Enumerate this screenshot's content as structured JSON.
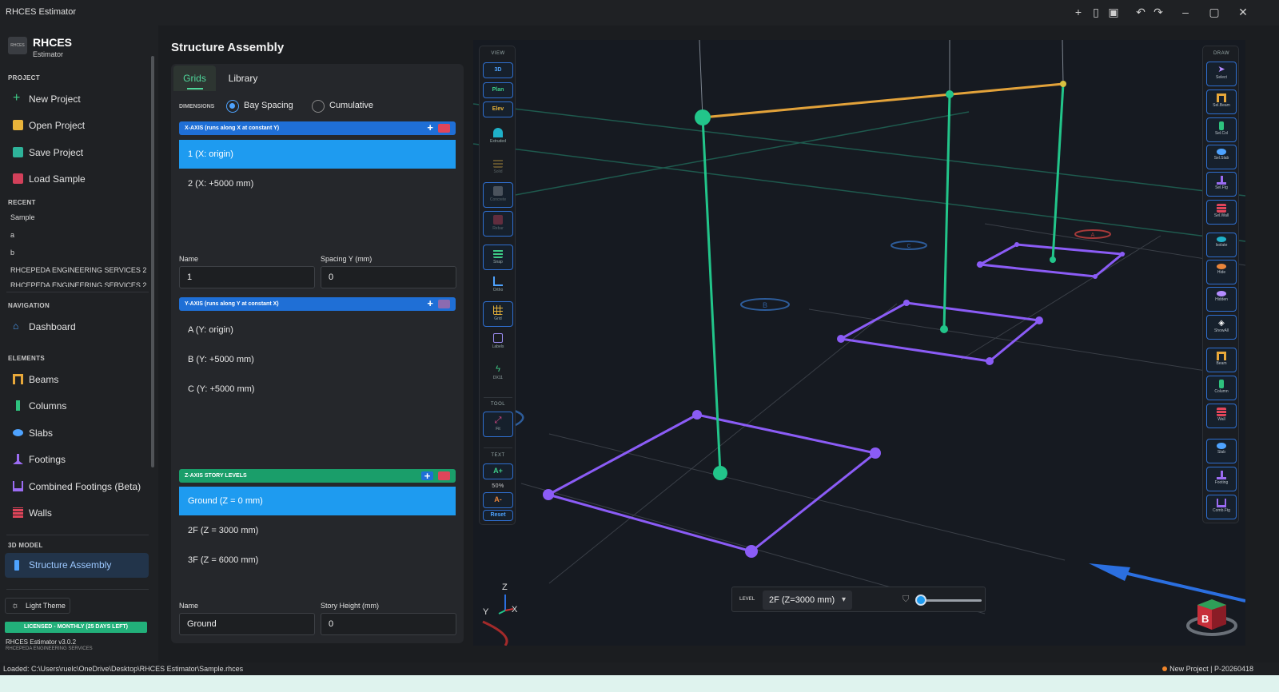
{
  "app": {
    "title": "RHCES Estimator"
  },
  "brand": {
    "logo_text": "RHCES",
    "name": "RHCES",
    "subtitle": "Estimator"
  },
  "sidebar": {
    "project_header": "PROJECT",
    "project_items": [
      "New Project",
      "Open Project",
      "Save Project",
      "Load Sample"
    ],
    "recent_header": "RECENT",
    "recent_items": [
      "Sample",
      "a",
      "b",
      "RHCEPEDA ENGINEERING SERVICES 2-...",
      "RHCEPEDA ENGINEERING SERVICES 2..."
    ],
    "navigation_header": "NAVIGATION",
    "navigation_items": [
      "Dashboard"
    ],
    "elements_header": "ELEMENTS",
    "element_items": [
      "Beams",
      "Columns",
      "Slabs",
      "Footings",
      "Combined Footings (Beta)",
      "Walls"
    ],
    "model_header": "3D MODEL",
    "model_items": [
      "Structure Assembly"
    ],
    "theme_toggle": "Light Theme",
    "license": "LICENSED - MONTHLY (25 DAYS LEFT)",
    "version": "RHCES Estimator v3.0.2",
    "company": "RHCEPEDA ENGINEERING SERVICES"
  },
  "panel": {
    "title": "Structure Assembly",
    "tabs": [
      "Grids",
      "Library"
    ],
    "dimensions_label": "DIMENSIONS",
    "dimension_modes": [
      "Bay Spacing",
      "Cumulative"
    ],
    "x_axis": {
      "header": "X-AXIS  (runs along X at constant Y)",
      "rows": [
        "1  (X: origin)",
        "2  (X: +5000 mm)"
      ],
      "name_label": "Name",
      "name_value": "1",
      "spacing_label": "Spacing Y (mm)",
      "spacing_value": "0"
    },
    "y_axis": {
      "header": "Y-AXIS  (runs along Y at constant X)",
      "rows": [
        "A  (Y: origin)",
        "B  (Y: +5000 mm)",
        "C  (Y: +5000 mm)"
      ]
    },
    "z_axis": {
      "header": "Z-AXIS  STORY LEVELS",
      "rows": [
        "Ground  (Z = 0 mm)",
        "2F  (Z = 3000 mm)",
        "3F  (Z = 6000 mm)"
      ],
      "name_label": "Name",
      "name_value": "Ground",
      "height_label": "Story Height (mm)",
      "height_value": "0"
    }
  },
  "view_palette": {
    "view_header": "VIEW",
    "view_buttons": [
      "3D",
      "Plan",
      "Elev"
    ],
    "toggles": [
      "Extruded",
      "Solid",
      "Concrete",
      "Rebar",
      "Snap",
      "Ortho",
      "Grid",
      "Labels",
      "DX11"
    ],
    "tool_header": "TOOL",
    "tool_buttons": [
      "Fit"
    ],
    "text_header": "TEXT",
    "text_increase": "A+",
    "text_percent": "50%",
    "text_decrease": "A-",
    "text_reset": "Reset"
  },
  "draw_palette": {
    "header": "DRAW",
    "buttons": [
      "Select",
      "Sel.Beam",
      "Sel.Col",
      "Sel.Slab",
      "Sel.Ftg",
      "Sel.Wall",
      "Isolate",
      "Hide",
      "Hidden",
      "ShowAll",
      "Beam",
      "Column",
      "Wall",
      "Slab",
      "Footing",
      "Comb.Ftg"
    ]
  },
  "viewport": {
    "level_label": "LEVEL",
    "level_value": "2F (Z=3000 mm)",
    "grid_bubbles": [
      "C",
      "B",
      "A"
    ],
    "axis_labels": {
      "z": "Z",
      "x": "X",
      "y": "Y"
    },
    "level_slider": 0.0,
    "nav_cube_face": "B"
  },
  "status": {
    "loaded": "Loaded: C:\\Users\\ruelc\\OneDrive\\Desktop\\RHCES Estimator\\Sample.rhces",
    "project": "New Project  |  P-20260418"
  },
  "colors": {
    "accent_green": "#22b07a",
    "accent_blue": "#1e9bf0",
    "slab_purple": "#8b5cf6",
    "column_green": "#22c58a",
    "beam_orange": "#e2a23a",
    "delete_red": "#e0455a"
  }
}
